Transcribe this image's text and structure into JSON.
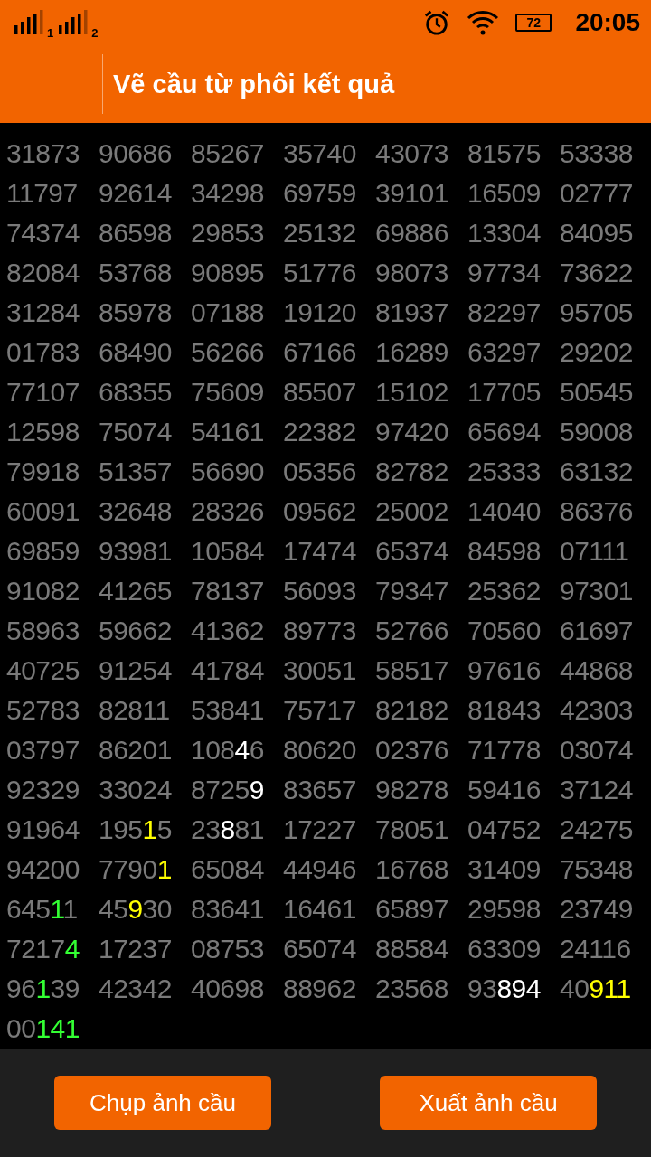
{
  "status_bar": {
    "sim_labels": [
      "1",
      "2"
    ],
    "battery": "72",
    "time": "20:05"
  },
  "app_bar": {
    "title": "Vẽ cầu từ phôi kết quả"
  },
  "grid": {
    "rows": [
      [
        "31873",
        "90686",
        "85267",
        "35740",
        "43073",
        "81575",
        "53338"
      ],
      [
        "11797",
        "92614",
        "34298",
        "69759",
        "39101",
        "16509",
        "02777"
      ],
      [
        "74374",
        "86598",
        "29853",
        "25132",
        "69886",
        "13304",
        "84095"
      ],
      [
        "82084",
        "53768",
        "90895",
        "51776",
        "98073",
        "97734",
        "73622"
      ],
      [
        "31284",
        "85978",
        "07188",
        "19120",
        "81937",
        "82297",
        "95705"
      ],
      [
        "01783",
        "68490",
        "56266",
        "67166",
        "16289",
        "63297",
        "29202"
      ],
      [
        "77107",
        "68355",
        "75609",
        "85507",
        "15102",
        "17705",
        "50545"
      ],
      [
        "12598",
        "75074",
        "54161",
        "22382",
        "97420",
        "65694",
        "59008"
      ],
      [
        "79918",
        "51357",
        "56690",
        "05356",
        "82782",
        "25333",
        "63132"
      ],
      [
        "60091",
        "32648",
        "28326",
        "09562",
        "25002",
        "14040",
        "86376"
      ],
      [
        "69859",
        "93981",
        "10584",
        "17474",
        "65374",
        "84598",
        "07111"
      ],
      [
        "91082",
        "41265",
        "78137",
        "56093",
        "79347",
        "25362",
        "97301"
      ],
      [
        "58963",
        "59662",
        "41362",
        "89773",
        "52766",
        "70560",
        "61697"
      ],
      [
        "40725",
        "91254",
        "41784",
        "30051",
        "58517",
        "97616",
        "44868"
      ],
      [
        "52783",
        "82811",
        "53841",
        "75717",
        "82182",
        "81843",
        "42303"
      ],
      [
        "03797",
        "86201",
        [
          {
            "text": "108"
          },
          {
            "text": "4",
            "color": "#ffffff"
          },
          {
            "text": "6"
          }
        ],
        "80620",
        "02376",
        "71778",
        "03074"
      ],
      [
        "92329",
        "33024",
        [
          {
            "text": "8725"
          },
          {
            "text": "9",
            "color": "#ffffff"
          }
        ],
        "83657",
        "98278",
        "59416",
        "37124"
      ],
      [
        "91964",
        [
          {
            "text": "195"
          },
          {
            "text": "1",
            "color": "#ffff00"
          },
          {
            "text": "5"
          }
        ],
        [
          {
            "text": "23"
          },
          {
            "text": "8",
            "color": "#ffffff"
          },
          {
            "text": "81"
          }
        ],
        "17227",
        "78051",
        "04752",
        "24275"
      ],
      [
        "94200",
        [
          {
            "text": "7790"
          },
          {
            "text": "1",
            "color": "#ffff00"
          }
        ],
        "65084",
        "44946",
        "16768",
        "31409",
        "75348"
      ],
      [
        [
          {
            "text": "645"
          },
          {
            "text": "1",
            "color": "#33ff33"
          },
          {
            "text": "1"
          }
        ],
        [
          {
            "text": "45"
          },
          {
            "text": "9",
            "color": "#ffff00"
          },
          {
            "text": "30"
          }
        ],
        "83641",
        "16461",
        "65897",
        "29598",
        "23749"
      ],
      [
        [
          {
            "text": "7217"
          },
          {
            "text": "4",
            "color": "#33ff33"
          }
        ],
        "17237",
        "08753",
        "65074",
        "88584",
        "63309",
        "24116"
      ],
      [
        [
          {
            "text": "96"
          },
          {
            "text": "1",
            "color": "#33ff33"
          },
          {
            "text": "39"
          }
        ],
        "42342",
        "40698",
        "88962",
        "23568",
        [
          {
            "text": "93"
          },
          {
            "text": "894",
            "color": "#ffffff"
          }
        ],
        [
          {
            "text": "40"
          },
          {
            "text": "911",
            "color": "#ffff00"
          }
        ]
      ],
      [
        [
          {
            "text": "00"
          },
          {
            "text": "141",
            "color": "#33ff33"
          }
        ]
      ]
    ]
  },
  "buttons": [
    "Chụp ảnh cầu",
    "Xuất ảnh cầu"
  ]
}
